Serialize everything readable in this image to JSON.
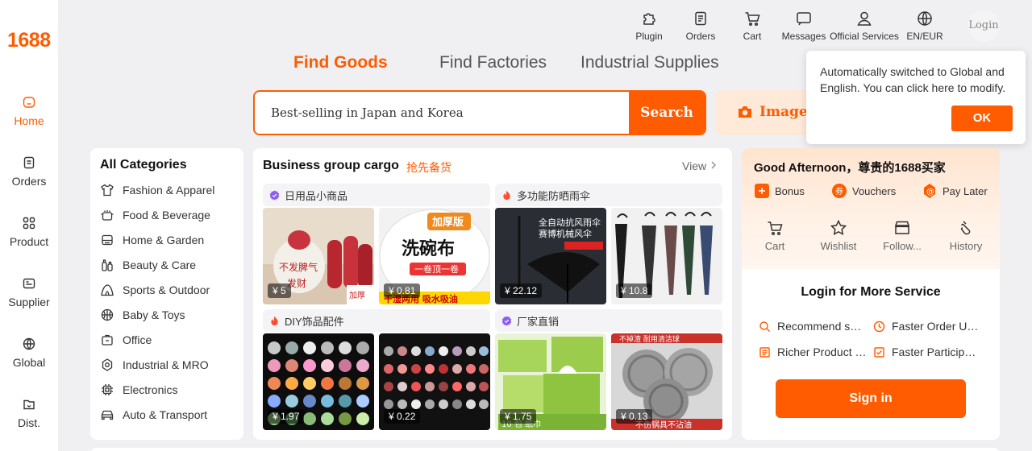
{
  "brand": {
    "logo": "1688",
    "accent": "#ff5b00"
  },
  "sidebar": {
    "items": [
      {
        "label": "Home",
        "icon": "home-icon",
        "active": true
      },
      {
        "label": "Orders",
        "icon": "clipboard-icon"
      },
      {
        "label": "Product",
        "icon": "grid-icon"
      },
      {
        "label": "Supplier",
        "icon": "supplier-icon"
      },
      {
        "label": "Global",
        "icon": "globe-icon"
      },
      {
        "label": "Dist.",
        "icon": "distribution-icon"
      }
    ]
  },
  "topnav": {
    "items": [
      {
        "label": "Plugin",
        "icon": "puzzle-icon"
      },
      {
        "label": "Orders",
        "icon": "clipboard-icon"
      },
      {
        "label": "Cart",
        "icon": "cart-icon"
      },
      {
        "label": "Messages",
        "icon": "message-icon"
      },
      {
        "label": "Official Services",
        "icon": "user-icon"
      },
      {
        "label": "EN/EUR",
        "icon": "globe-icon"
      }
    ],
    "login": "Login"
  },
  "tabs": [
    {
      "label": "Find Goods",
      "active": true
    },
    {
      "label": "Find Factories"
    },
    {
      "label": "Industrial Supplies"
    }
  ],
  "search": {
    "value": "Best-selling in Japan and Korea",
    "button": "Search",
    "image_search": "Image Search"
  },
  "popup": {
    "text": "Automatically switched to Global and English. You can click here to modify.",
    "ok": "OK"
  },
  "categories": {
    "title": "All Categories",
    "items": [
      {
        "label": "Fashion & Apparel",
        "icon": "shirt-icon"
      },
      {
        "label": "Food & Beverage",
        "icon": "pot-icon"
      },
      {
        "label": "Home & Garden",
        "icon": "sofa-icon"
      },
      {
        "label": "Beauty & Care",
        "icon": "bottles-icon"
      },
      {
        "label": "Sports & Outdoor",
        "icon": "tent-icon"
      },
      {
        "label": "Baby & Toys",
        "icon": "ball-icon"
      },
      {
        "label": "Office",
        "icon": "briefcase-icon"
      },
      {
        "label": "Industrial & MRO",
        "icon": "gear-icon"
      },
      {
        "label": "Electronics",
        "icon": "chip-icon"
      },
      {
        "label": "Auto & Transport",
        "icon": "car-icon"
      }
    ]
  },
  "cargo": {
    "title": "Business group cargo",
    "subtitle": "抢先备货",
    "view": "View",
    "groups": [
      {
        "name": "日用品小商品",
        "badge": "purple",
        "products": [
          {
            "price": "¥ 5"
          },
          {
            "price": "¥ 0.81"
          }
        ]
      },
      {
        "name": "多功能防晒雨伞",
        "badge": "fire",
        "products": [
          {
            "price": "¥ 22.12"
          },
          {
            "price": "¥ 10.8"
          }
        ]
      },
      {
        "name": "DIY饰品配件",
        "badge": "fire",
        "products": [
          {
            "price": "¥ 1.97"
          },
          {
            "price": "¥ 0.22"
          }
        ]
      },
      {
        "name": "厂家直销",
        "badge": "purple",
        "products": [
          {
            "price": "¥ 1.75"
          },
          {
            "price": "¥ 0.13"
          }
        ]
      }
    ]
  },
  "right": {
    "greeting": "Good Afternoon，尊贵的1688买家",
    "perks": [
      {
        "label": "Bonus",
        "color": "#ff5b00"
      },
      {
        "label": "Vouchers",
        "color": "#ff5b00"
      },
      {
        "label": "Pay Later",
        "color": "#ff5b00"
      }
    ],
    "quick": [
      {
        "label": "Cart",
        "icon": "cart-icon"
      },
      {
        "label": "Wishlist",
        "icon": "star-icon"
      },
      {
        "label": "Follow...",
        "icon": "store-icon"
      },
      {
        "label": "History",
        "icon": "history-icon"
      }
    ],
    "login_title": "Login for More Service",
    "services": [
      {
        "label": "Recommend s…",
        "icon": "search-icon"
      },
      {
        "label": "Faster Order U…",
        "icon": "clock-icon"
      },
      {
        "label": "Richer Product …",
        "icon": "document-icon"
      },
      {
        "label": "Faster Particip…",
        "icon": "check-icon"
      }
    ],
    "sign_in": "Sign in"
  }
}
